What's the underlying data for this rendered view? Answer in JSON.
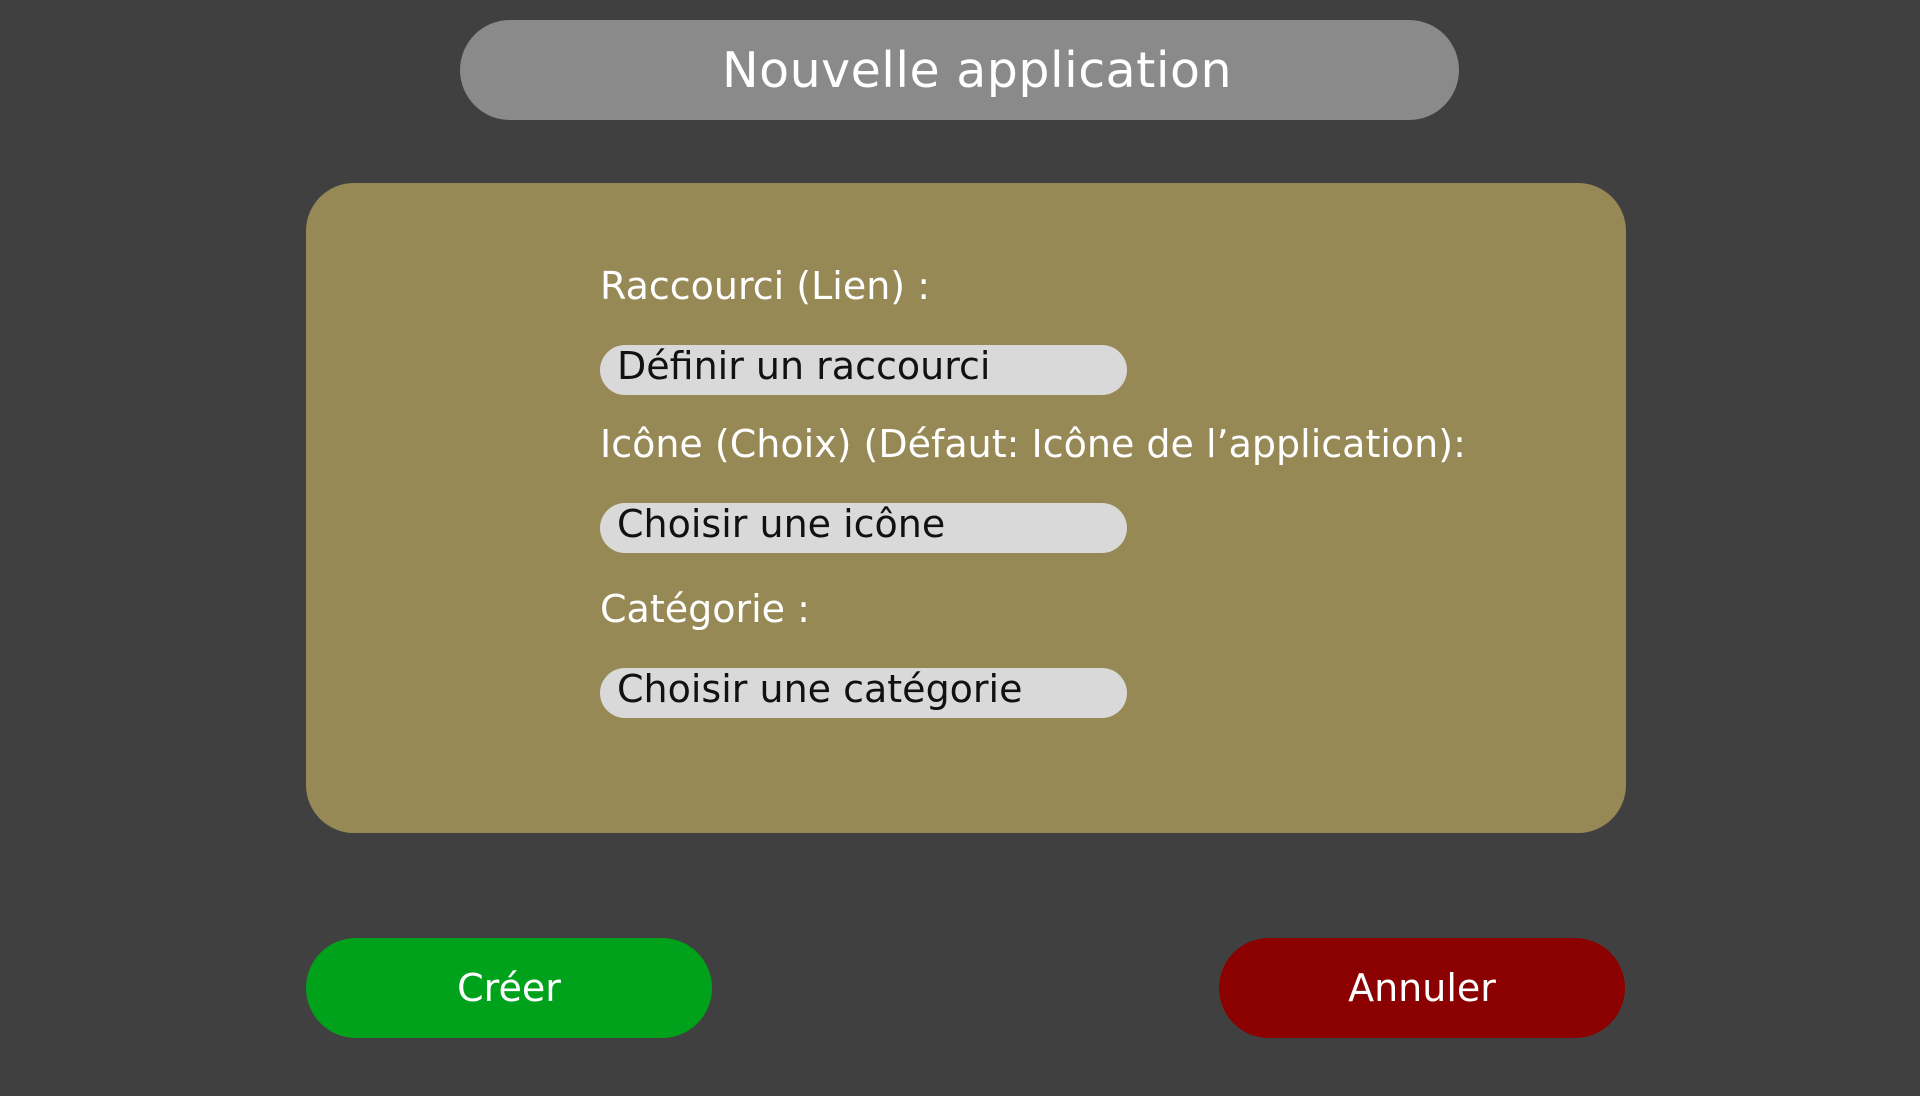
{
  "dialog": {
    "title": "Nouvelle application"
  },
  "form": {
    "shortcut_label": "Raccourci (Lien) :",
    "shortcut_field": "Définir un raccourci",
    "icon_label": "Icône (Choix) (Défaut: Icône de l’application):",
    "icon_field": "Choisir une icône",
    "category_label": "Catégorie :",
    "category_field": "Choisir une catégorie"
  },
  "actions": {
    "create_label": "Créer",
    "cancel_label": "Annuler"
  },
  "colors": {
    "background": "#404040",
    "title_pill": "#8a8a8a",
    "panel": "#978955",
    "field": "#d9d9d9",
    "create": "#00a21b",
    "cancel": "#8b0000"
  }
}
